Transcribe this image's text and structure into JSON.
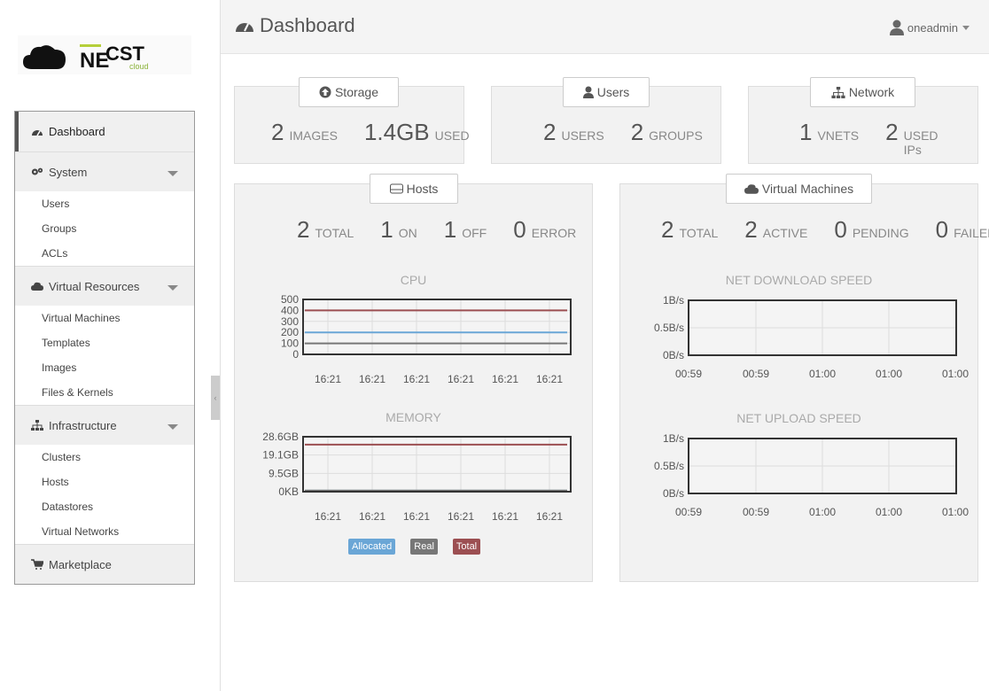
{
  "app": {
    "brand_a": "NE",
    "brand_b": "CST",
    "brand_sub": "cloud"
  },
  "sidebar": {
    "sections": [
      {
        "label": "Dashboard",
        "icon": "dashboard-icon"
      },
      {
        "label": "System",
        "icon": "cogs-icon",
        "items": [
          "Users",
          "Groups",
          "ACLs"
        ]
      },
      {
        "label": "Virtual Resources",
        "icon": "cloud-icon",
        "items": [
          "Virtual Machines",
          "Templates",
          "Images",
          "Files & Kernels"
        ]
      },
      {
        "label": "Infrastructure",
        "icon": "sitemap-icon",
        "items": [
          "Clusters",
          "Hosts",
          "Datastores",
          "Virtual Networks"
        ]
      },
      {
        "label": "Marketplace",
        "icon": "cart-icon"
      }
    ],
    "collapse_glyph": "‹"
  },
  "header": {
    "title": "Dashboard",
    "user": "oneadmin"
  },
  "storage": {
    "button": "Storage",
    "images_value": "2",
    "images_label": "IMAGES",
    "used_value": "1.4GB",
    "used_label": "USED"
  },
  "users": {
    "button": "Users",
    "users_value": "2",
    "users_label": "USERS",
    "groups_value": "2",
    "groups_label": "GROUPS"
  },
  "network": {
    "button": "Network",
    "vnets_value": "1",
    "vnets_label": "VNETS",
    "ips_value": "2",
    "ips_label": "USED IPs"
  },
  "hosts": {
    "button": "Hosts",
    "stats": [
      {
        "value": "2",
        "label": "TOTAL"
      },
      {
        "value": "1",
        "label": "ON"
      },
      {
        "value": "1",
        "label": "OFF"
      },
      {
        "value": "0",
        "label": "ERROR"
      }
    ],
    "legend": [
      {
        "label": "Allocated",
        "color": "#6aa6d6"
      },
      {
        "label": "Real",
        "color": "#777777"
      },
      {
        "label": "Total",
        "color": "#9c4f52"
      }
    ]
  },
  "vms": {
    "button": "Virtual Machines",
    "stats": [
      {
        "value": "2",
        "label": "TOTAL"
      },
      {
        "value": "2",
        "label": "ACTIVE"
      },
      {
        "value": "0",
        "label": "PENDING"
      },
      {
        "value": "0",
        "label": "FAILED"
      }
    ]
  },
  "chart_data": [
    {
      "type": "line",
      "title": "CPU",
      "x": [
        "16:21",
        "16:21",
        "16:21",
        "16:21",
        "16:21",
        "16:21"
      ],
      "y_ticks": [
        "500",
        "400",
        "300",
        "200",
        "100",
        "0"
      ],
      "ylim": [
        0,
        500
      ],
      "series": [
        {
          "name": "Total",
          "color": "#9c4f52",
          "values": [
            400,
            400,
            400,
            400,
            400,
            400
          ]
        },
        {
          "name": "Allocated",
          "color": "#6aa6d6",
          "values": [
            200,
            200,
            200,
            200,
            200,
            200
          ]
        },
        {
          "name": "Real",
          "color": "#777777",
          "values": [
            100,
            100,
            100,
            100,
            100,
            100
          ]
        }
      ],
      "grid": true
    },
    {
      "type": "line",
      "title": "MEMORY",
      "x": [
        "16:21",
        "16:21",
        "16:21",
        "16:21",
        "16:21",
        "16:21"
      ],
      "y_ticks": [
        "28.6GB",
        "19.1GB",
        "9.5GB",
        "0KB"
      ],
      "ylim": [
        0,
        28.6
      ],
      "series": [
        {
          "name": "Total",
          "color": "#9c4f52",
          "values": [
            24.5,
            24.5,
            24.5,
            24.5,
            24.5,
            24.5
          ]
        },
        {
          "name": "Allocated",
          "color": "#6aa6d6",
          "values": [
            0.5,
            0.5,
            0.5,
            0.5,
            0.5,
            0.5
          ]
        },
        {
          "name": "Real",
          "color": "#777777",
          "values": [
            0.6,
            0.6,
            0.6,
            0.6,
            0.6,
            0.6
          ]
        }
      ],
      "grid": true
    },
    {
      "type": "line",
      "title": "NET DOWNLOAD SPEED",
      "x": [
        "00:59",
        "00:59",
        "01:00",
        "01:00",
        "01:00"
      ],
      "y_ticks": [
        "1B/s",
        "0.5B/s",
        "0B/s"
      ],
      "ylim": [
        0,
        1
      ],
      "series": [
        {
          "color": "#6aa6d6",
          "x_start_index": 2,
          "values": [
            0,
            0,
            0
          ]
        }
      ],
      "grid": true
    },
    {
      "type": "line",
      "title": "NET UPLOAD SPEED",
      "x": [
        "00:59",
        "00:59",
        "01:00",
        "01:00",
        "01:00"
      ],
      "y_ticks": [
        "1B/s",
        "0.5B/s",
        "0B/s"
      ],
      "ylim": [
        0,
        1
      ],
      "series": [
        {
          "color": "#6aa6d6",
          "x_start_index": 2,
          "values": [
            0,
            0,
            0
          ]
        }
      ],
      "grid": true
    }
  ]
}
